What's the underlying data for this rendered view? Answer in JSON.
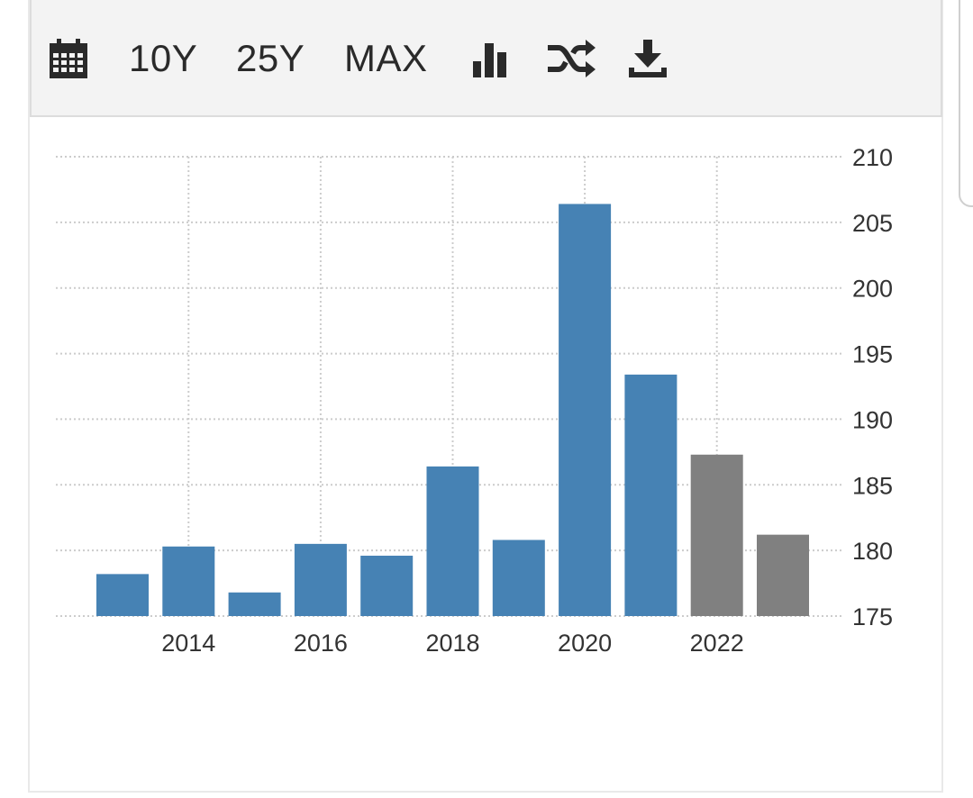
{
  "toolbar": {
    "items": [
      {
        "type": "icon",
        "name": "calendar-icon"
      },
      {
        "type": "text",
        "label": "10Y"
      },
      {
        "type": "text",
        "label": "25Y"
      },
      {
        "type": "text",
        "label": "MAX"
      },
      {
        "type": "icon",
        "name": "bar-chart-icon"
      },
      {
        "type": "icon",
        "name": "shuffle-icon"
      },
      {
        "type": "icon",
        "name": "download-icon"
      }
    ]
  },
  "chart_data": {
    "type": "bar",
    "x": [
      2013,
      2014,
      2015,
      2016,
      2017,
      2018,
      2019,
      2020,
      2021,
      2022,
      2023
    ],
    "values": [
      178.2,
      180.3,
      176.8,
      180.5,
      179.6,
      186.4,
      180.8,
      206.4,
      193.4,
      187.3,
      181.2
    ],
    "forecast": [
      false,
      false,
      false,
      false,
      false,
      false,
      false,
      false,
      false,
      true,
      true
    ],
    "x_tick_labels": [
      "2014",
      "2016",
      "2018",
      "2020",
      "2022"
    ],
    "y_tick_labels": [
      "175",
      "180",
      "185",
      "190",
      "195",
      "200",
      "205",
      "210"
    ],
    "ylim": [
      175,
      210
    ],
    "y_axis_position": "right",
    "grid": true,
    "title": "",
    "xlabel": "",
    "ylabel": "",
    "colors": {
      "actual": "#4682b4",
      "forecast": "#808080",
      "grid": "#cccccc",
      "text": "#333333"
    }
  }
}
